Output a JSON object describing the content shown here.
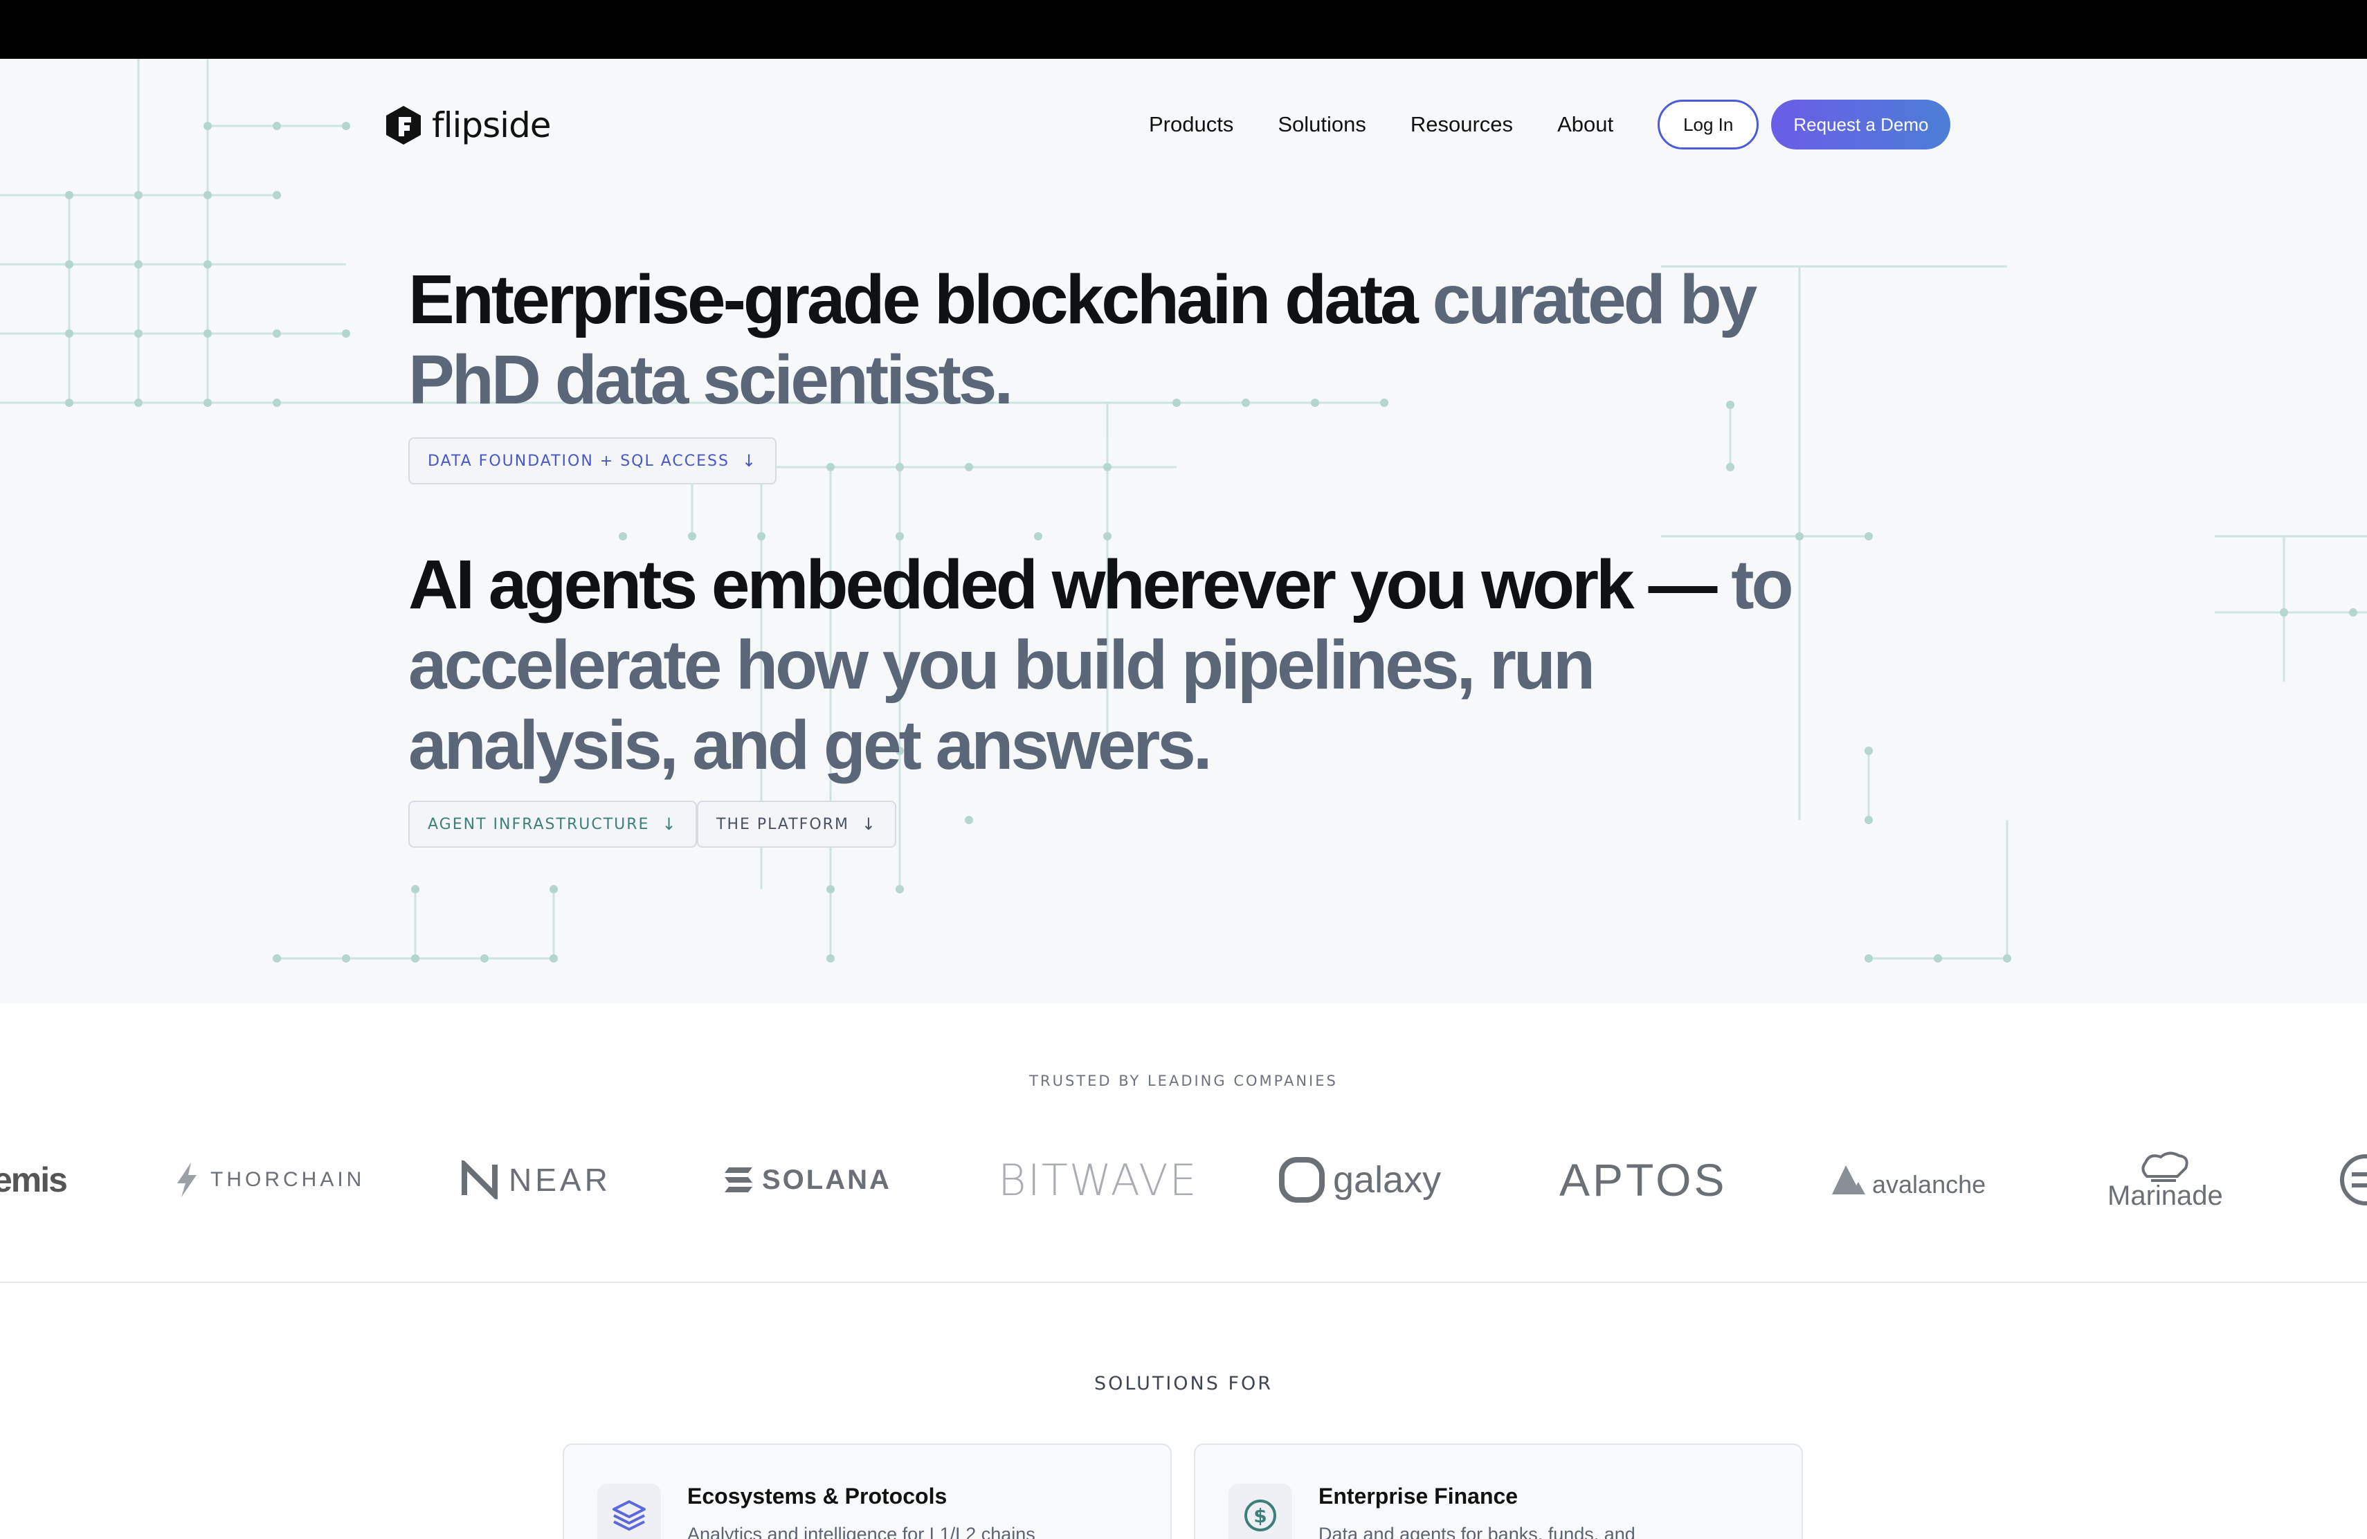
{
  "nav": {
    "logo_text": "flipside",
    "links": [
      "Products",
      "Solutions",
      "Resources",
      "About"
    ],
    "login_label": "Log In",
    "demo_label": "Request a Demo"
  },
  "hero": {
    "headline1_dark": "Enterprise-grade blockchain data ",
    "headline1_muted": "curated by PhD data scientists.",
    "pill_data_foundation": "DATA FOUNDATION + SQL ACCESS",
    "headline2_dark": "AI agents embedded wherever you work — ",
    "headline2_muted": "to accelerate how you build pipelines, run analysis, and get answers.",
    "pill_agent_infra": "AGENT INFRASTRUCTURE",
    "pill_platform": "THE PLATFORM",
    "arrow": "↓"
  },
  "trusted": {
    "label": "TRUSTED BY LEADING COMPANIES",
    "logos": [
      "emis",
      "THORCHAIN",
      "NEAR",
      "SOLANA",
      "BITWAVE",
      "galaxy",
      "APTOS",
      "avalanche",
      "Marinade"
    ]
  },
  "solutions": {
    "label": "SOLUTIONS FOR",
    "cards": [
      {
        "title": "Ecosystems & Protocols",
        "desc": "Analytics and intelligence for L1/L2 chains"
      },
      {
        "title": "Enterprise Finance",
        "desc": "Data and agents for banks, funds, and"
      }
    ]
  },
  "colors": {
    "accent": "#5b6ad8",
    "muted_text": "#5c6679",
    "grid_line": "#b9d9d3"
  }
}
